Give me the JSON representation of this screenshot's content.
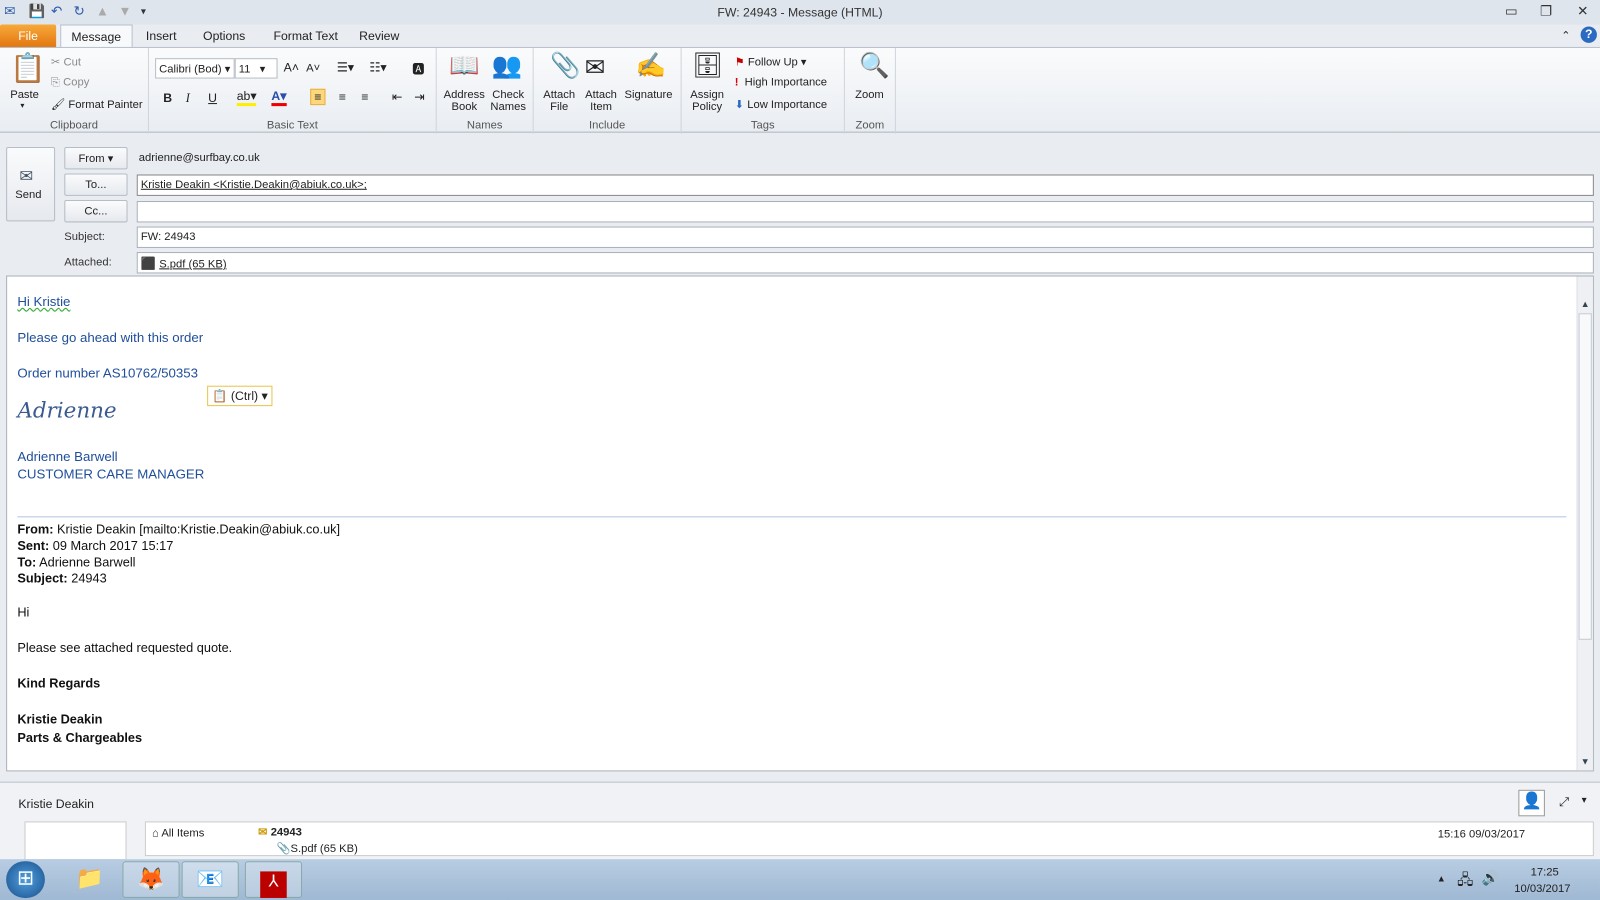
{
  "window": {
    "title": "FW: 24943  -  Message (HTML)"
  },
  "tabs": [
    "File",
    "Message",
    "Insert",
    "Options",
    "Format Text",
    "Review"
  ],
  "ribbon": {
    "clipboard": {
      "label": "Clipboard",
      "paste": "Paste",
      "cut": "Cut",
      "copy": "Copy",
      "format_painter": "Format Painter"
    },
    "basic_text": {
      "label": "Basic Text",
      "font": "Calibri (Body)",
      "font_display": "Calibri (Bod)",
      "size": "11",
      "bold": "B",
      "italic": "I",
      "underline": "U"
    },
    "names": {
      "label": "Names",
      "address_book": "Address Book",
      "check_names": "Check Names"
    },
    "include": {
      "label": "Include",
      "attach_file": "Attach File",
      "attach_item": "Attach Item",
      "signature": "Signature"
    },
    "tags": {
      "label": "Tags",
      "assign_policy": "Assign Policy",
      "follow_up": "Follow Up",
      "high": "High Importance",
      "low": "Low Importance"
    },
    "zoom": {
      "label": "Zoom",
      "zoom": "Zoom"
    }
  },
  "header": {
    "send": "Send",
    "from_btn": "From",
    "from_value": "adrienne@surfbay.co.uk",
    "to_btn": "To...",
    "to_value": "Kristie Deakin <Kristie.Deakin@abiuk.co.uk>;",
    "cc_btn": "Cc...",
    "cc_value": "",
    "subject_label": "Subject:",
    "subject_value": "FW: 24943",
    "attached_label": "Attached:",
    "attachment": "S.pdf (65 KB)"
  },
  "body": {
    "greeting": "Hi Kristie",
    "line1": "Please go ahead with this order",
    "order": "Order number  AS10762/50353",
    "signature_script": "Adrienne",
    "sig_name": "Adrienne Barwell",
    "sig_title": "CUSTOMER CARE MANAGER",
    "paste_options": "(Ctrl)",
    "fwd": {
      "from_label": "From:",
      "from": "Kristie Deakin [mailto:Kristie.Deakin@abiuk.co.uk]",
      "sent_label": "Sent:",
      "sent": "09 March 2017 15:17",
      "to_label": "To:",
      "to": "Adrienne Barwell",
      "subject_label": "Subject:",
      "subject": "24943",
      "hi": "Hi",
      "msg": "Please see attached requested quote.",
      "regards": "Kind Regards",
      "name": "Kristie Deakin",
      "dept": "Parts & Chargeables"
    }
  },
  "people_pane": {
    "name": "Kristie Deakin",
    "all_items": "All Items",
    "item_subject": "24943",
    "item_attachment": "S.pdf (65 KB)",
    "item_time": "15:16  09/03/2017"
  },
  "taskbar": {
    "time": "17:25",
    "date": "10/03/2017"
  },
  "colors": {
    "file_tab": "#e2740e",
    "body_blue": "#1f4e9a",
    "taskbar": "#a9c0da"
  }
}
